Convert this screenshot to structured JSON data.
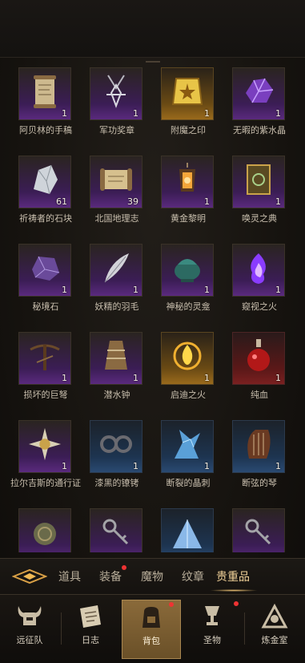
{
  "items": [
    {
      "name": "阿贝林的手稿",
      "count": "1",
      "rarity": "purple",
      "icon": "scroll-icon"
    },
    {
      "name": "军功奖章",
      "count": "1",
      "rarity": "purple",
      "icon": "medal-icon"
    },
    {
      "name": "附魔之印",
      "count": "1",
      "rarity": "gold",
      "icon": "seal-gem-icon"
    },
    {
      "name": "无暇的紫水晶",
      "count": "1",
      "rarity": "purple",
      "icon": "amethyst-icon"
    },
    {
      "name": "祈祷者的石块",
      "count": "61",
      "rarity": "purple",
      "icon": "crystal-rock-icon"
    },
    {
      "name": "北国地理志",
      "count": "39",
      "rarity": "purple",
      "icon": "map-scroll-icon"
    },
    {
      "name": "黄金黎明",
      "count": "1",
      "rarity": "purple",
      "icon": "lantern-icon"
    },
    {
      "name": "唤灵之典",
      "count": "1",
      "rarity": "purple",
      "icon": "tome-icon"
    },
    {
      "name": "秘境石",
      "count": "1",
      "rarity": "purple",
      "icon": "purple-stone-icon"
    },
    {
      "name": "妖精的羽毛",
      "count": "1",
      "rarity": "purple",
      "icon": "feather-icon"
    },
    {
      "name": "神秘的灵龛",
      "count": "1",
      "rarity": "purple",
      "icon": "censer-icon"
    },
    {
      "name": "窥视之火",
      "count": "1",
      "rarity": "purple",
      "icon": "purple-flame-icon"
    },
    {
      "name": "损坏的巨弩",
      "count": "1",
      "rarity": "purple",
      "icon": "crossbow-icon"
    },
    {
      "name": "潜水钟",
      "count": "1",
      "rarity": "purple",
      "icon": "diving-bell-icon"
    },
    {
      "name": "启迪之火",
      "count": "1",
      "rarity": "gold",
      "icon": "gold-flame-icon"
    },
    {
      "name": "纯血",
      "count": "1",
      "rarity": "red",
      "icon": "blood-flask-icon"
    },
    {
      "name": "拉尔吉斯的通行证",
      "count": "1",
      "rarity": "purple",
      "icon": "sun-badge-icon"
    },
    {
      "name": "漆黑的镣铐",
      "count": "1",
      "rarity": "blue",
      "icon": "shackles-icon"
    },
    {
      "name": "断裂的晶刺",
      "count": "1",
      "rarity": "blue",
      "icon": "crystal-spike-icon"
    },
    {
      "name": "断弦的琴",
      "count": "1",
      "rarity": "blue",
      "icon": "lyre-icon"
    },
    {
      "name": "",
      "count": "",
      "rarity": "purple",
      "icon": "bronze-orb-icon"
    },
    {
      "name": "",
      "count": "",
      "rarity": "purple",
      "icon": "key-icon"
    },
    {
      "name": "",
      "count": "",
      "rarity": "blue",
      "icon": "crystal-shard-icon"
    },
    {
      "name": "",
      "count": "",
      "rarity": "purple",
      "icon": "key-icon"
    }
  ],
  "tabs": [
    {
      "label": "道具",
      "active": false,
      "notify": false
    },
    {
      "label": "装备",
      "active": false,
      "notify": true
    },
    {
      "label": "魔物",
      "active": false,
      "notify": false
    },
    {
      "label": "纹章",
      "active": false,
      "notify": false
    },
    {
      "label": "贵重品",
      "active": true,
      "notify": false
    }
  ],
  "nav": [
    {
      "label": "远征队",
      "icon": "horned-helmet-icon",
      "active": false,
      "notify": false
    },
    {
      "label": "日志",
      "icon": "journal-icon",
      "active": false,
      "notify": false
    },
    {
      "label": "背包",
      "icon": "backpack-icon",
      "active": true,
      "notify": true
    },
    {
      "label": "圣物",
      "icon": "relic-chalice-icon",
      "active": false,
      "notify": true
    },
    {
      "label": "炼金室",
      "icon": "alchemy-icon",
      "active": false,
      "notify": false
    }
  ],
  "colors": {
    "accent": "#f3d39a",
    "notify": "#e33333",
    "purple": "#5a2a7e",
    "gold": "#9a6a1c",
    "blue": "#2a4a72",
    "red": "#7a2020"
  }
}
